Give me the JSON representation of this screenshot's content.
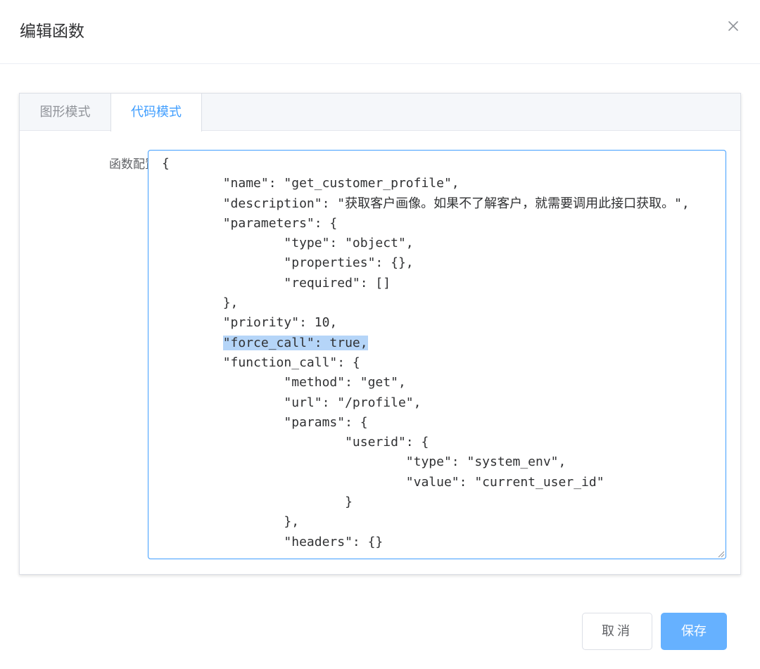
{
  "dialog": {
    "title": "编辑函数",
    "close_icon": "close-icon"
  },
  "tabs": [
    {
      "label": "图形模式",
      "active": false
    },
    {
      "label": "代码模式",
      "active": true
    }
  ],
  "form": {
    "label": "函数配置",
    "code_lines": {
      "before_highlight": "{\n\t\"name\": \"get_customer_profile\",\n\t\"description\": \"获取客户画像。如果不了解客户，就需要调用此接口获取。\",\n\t\"parameters\": {\n\t\t\"type\": \"object\",\n\t\t\"properties\": {},\n\t\t\"required\": []\n\t},\n\t\"priority\": 10,\n\t",
      "highlight": "\"force_call\": true,",
      "after_highlight": "\n\t\"function_call\": {\n\t\t\"method\": \"get\",\n\t\t\"url\": \"/profile\",\n\t\t\"params\": {\n\t\t\t\"userid\": {\n\t\t\t\t\"type\": \"system_env\",\n\t\t\t\t\"value\": \"current_user_id\"\n\t\t\t}\n\t\t},\n\t\t\"headers\": {}"
    }
  },
  "footer": {
    "cancel_label": "取消",
    "save_label": "保存"
  },
  "colors": {
    "accent": "#409eff",
    "save_button": "#66b1ff",
    "selection": "#b5d5f8"
  }
}
